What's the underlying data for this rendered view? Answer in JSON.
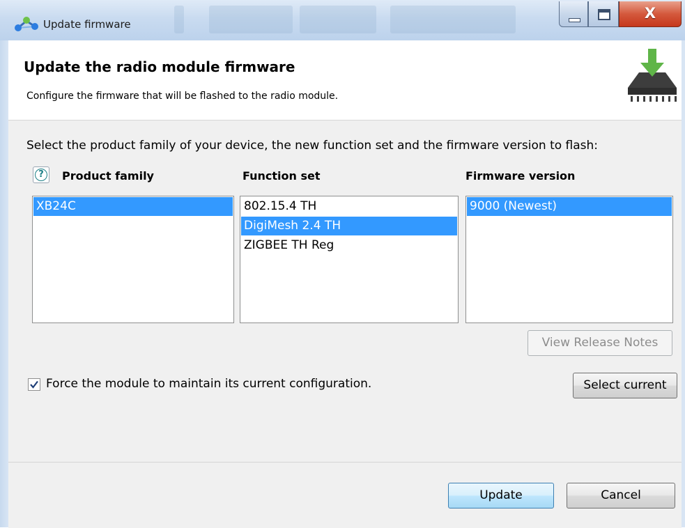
{
  "window": {
    "title": "Update firmware",
    "controls": {
      "minimize": "minimize",
      "maximize": "maximize",
      "close": "X"
    }
  },
  "header": {
    "title": "Update the radio module firmware",
    "description": "Configure the firmware that will be flashed to the radio module.",
    "icon": "firmware-flash-icon"
  },
  "main": {
    "instruction": "Select the product family of your device, the new function set and the firmware version to flash:",
    "columns": {
      "product_family": {
        "header": "Product family",
        "items": [
          {
            "label": "XB24C",
            "selected": true
          }
        ]
      },
      "function_set": {
        "header": "Function set",
        "items": [
          {
            "label": "802.15.4 TH",
            "selected": false
          },
          {
            "label": "DigiMesh 2.4 TH",
            "selected": true
          },
          {
            "label": "ZIGBEE TH Reg",
            "selected": false
          }
        ]
      },
      "firmware_version": {
        "header": "Firmware version",
        "items": [
          {
            "label": "9000 (Newest)",
            "selected": true
          }
        ]
      }
    },
    "view_release_notes_label": "View Release Notes",
    "select_current_label": "Select current",
    "force_config": {
      "label": "Force the module to maintain its current configuration.",
      "checked": true
    }
  },
  "footer": {
    "update_label": "Update",
    "cancel_label": "Cancel"
  },
  "colors": {
    "selection": "#3399ff",
    "titlebar": "#c9dbf0",
    "close_button": "#c5371b",
    "download_arrow": "#5fb548"
  }
}
